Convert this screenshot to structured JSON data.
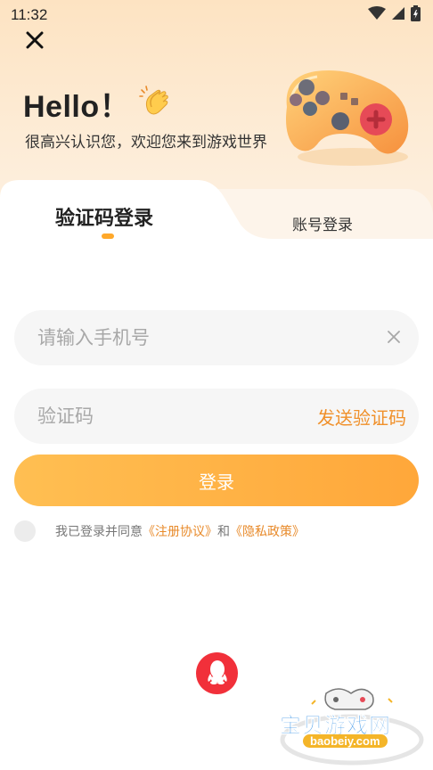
{
  "status_bar": {
    "time": "11:32",
    "icons": [
      "wifi-icon",
      "cellular-signal-icon",
      "battery-icon"
    ]
  },
  "header": {
    "close_icon": "close-icon",
    "title": "Hello！",
    "title_emoji_icon": "clapping-hands-icon",
    "subtitle": "很高兴认识您，欢迎您来到游戏世界",
    "illustration": "gamepad-icon"
  },
  "tabs": [
    {
      "label": "验证码登录",
      "active": true
    },
    {
      "label": "账号登录",
      "active": false
    }
  ],
  "form": {
    "phone_placeholder": "请输入手机号",
    "phone_value": "",
    "code_placeholder": "验证码",
    "code_value": "",
    "send_code_label": "发送验证码",
    "login_label": "登录"
  },
  "agreement": {
    "checked": false,
    "prefix": "我已登录并同意",
    "terms_link": "《注册协议》",
    "and": "和",
    "privacy_link": "《隐私政策》"
  },
  "third_party": {
    "qq_icon": "qq-penguin-icon"
  },
  "watermark": {
    "title": "宝贝游戏网",
    "url": "baobeiy.com"
  },
  "colors": {
    "accent": "#FFA73A",
    "link": "#E88A2A",
    "qq_red": "#F1303A"
  }
}
